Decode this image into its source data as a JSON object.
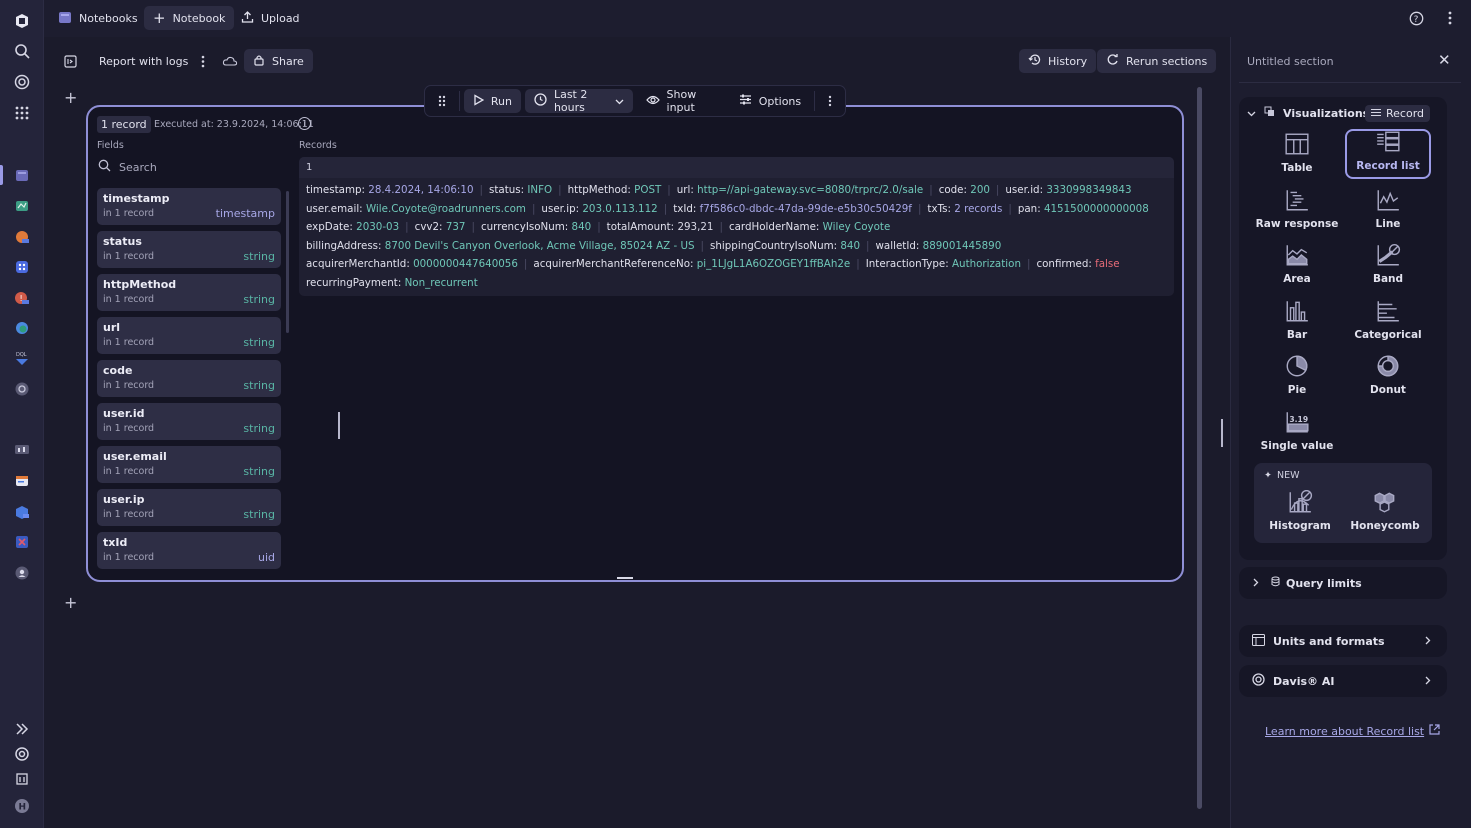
{
  "topbar": {
    "app_name": "Notebooks",
    "new_notebook_label": "Notebook",
    "upload_label": "Upload"
  },
  "notebook": {
    "title": "Report with logs",
    "share_label": "Share",
    "history_label": "History",
    "rerun_label": "Rerun sections"
  },
  "section_toolbar": {
    "run_label": "Run",
    "timeframe": "Last 2 hours",
    "show_input_label": "Show input",
    "options_label": "Options"
  },
  "result": {
    "record_badge": "1 record",
    "executed_at": "Executed at: 23.9.2024, 14:06:11",
    "fields_label": "Fields",
    "records_label": "Records",
    "search_placeholder": "Search",
    "fields": [
      {
        "name": "timestamp",
        "count": "in 1 record",
        "type": "timestamp"
      },
      {
        "name": "status",
        "count": "in 1 record",
        "type": "string"
      },
      {
        "name": "httpMethod",
        "count": "in 1 record",
        "type": "string"
      },
      {
        "name": "url",
        "count": "in 1 record",
        "type": "string"
      },
      {
        "name": "code",
        "count": "in 1 record",
        "type": "string"
      },
      {
        "name": "user.id",
        "count": "in 1 record",
        "type": "string"
      },
      {
        "name": "user.email",
        "count": "in 1 record",
        "type": "string"
      },
      {
        "name": "user.ip",
        "count": "in 1 record",
        "type": "string"
      },
      {
        "name": "txId",
        "count": "in 1 record",
        "type": "uid"
      }
    ],
    "record_index": "1",
    "record_lines": [
      [
        {
          "k": "timestamp",
          "v": "28.4.2024, 14:06:10",
          "c": "vp"
        },
        {
          "k": "status",
          "v": "INFO",
          "c": "v"
        },
        {
          "k": "httpMethod",
          "v": "POST",
          "c": "v"
        },
        {
          "k": "url",
          "v": "http=//api-gateway.svc=8080/trprc/2.0/sale",
          "c": "v"
        },
        {
          "k": "code",
          "v": "200",
          "c": "v"
        },
        {
          "k": "user.id",
          "v": "3330998349843",
          "c": "v"
        }
      ],
      [
        {
          "k": "user.email",
          "v": "Wile.Coyote@roadrunners.com",
          "c": "v"
        },
        {
          "k": "user.ip",
          "v": "203.0.113.112",
          "c": "v"
        },
        {
          "k": "txId",
          "v": "f7f586c0-dbdc-47da-99de-e5b30c50429f",
          "c": "vp"
        },
        {
          "k": "txTs",
          "v": "2 records",
          "c": "vp"
        },
        {
          "k": "pan",
          "v": "4151500000000008",
          "c": "v"
        }
      ],
      [
        {
          "k": "expDate",
          "v": "2030-03",
          "c": "v"
        },
        {
          "k": "cvv2",
          "v": "737",
          "c": "v"
        },
        {
          "k": "currencyIsoNum",
          "v": "840",
          "c": "v"
        },
        {
          "k": "totalAmount",
          "v": "293,21",
          "c": "vw"
        },
        {
          "k": "cardHolderName",
          "v": "Wiley Coyote",
          "c": "v"
        }
      ],
      [
        {
          "k": "billingAddress",
          "v": "8700 Devil's Canyon Overlook, Acme Village, 85024 AZ - US",
          "c": "v"
        },
        {
          "k": "shippingCountryIsoNum",
          "v": "840",
          "c": "v"
        },
        {
          "k": "walletId",
          "v": "889001445890",
          "c": "v"
        }
      ],
      [
        {
          "k": "acquirerMerchantId",
          "v": "0000000447640056",
          "c": "v"
        },
        {
          "k": "acquirerMerchantReferenceNo",
          "v": "pi_1LJgL1A6OZOGEY1ffBAh2e",
          "c": "v"
        },
        {
          "k": "InteractionType",
          "v": "Authorization",
          "c": "v"
        },
        {
          "k": "confirmed",
          "v": "false",
          "c": "vr"
        }
      ],
      [
        {
          "k": "recurringPayment",
          "v": "Non_recurrent",
          "c": "v"
        }
      ]
    ]
  },
  "right_panel": {
    "title": "Untitled section",
    "visualizations_label": "Visualizations",
    "record_pill": "Record",
    "viz_options": [
      {
        "label": "Table",
        "icon": "table-icon",
        "selected": false
      },
      {
        "label": "Record list",
        "icon": "record-list-icon",
        "selected": true
      },
      {
        "label": "Raw response",
        "icon": "raw-response-icon",
        "selected": false
      },
      {
        "label": "Line",
        "icon": "line-chart-icon",
        "selected": false
      },
      {
        "label": "Area",
        "icon": "area-chart-icon",
        "selected": false
      },
      {
        "label": "Band",
        "icon": "band-chart-icon",
        "selected": false
      },
      {
        "label": "Bar",
        "icon": "bar-chart-icon",
        "selected": false
      },
      {
        "label": "Categorical",
        "icon": "categorical-chart-icon",
        "selected": false
      },
      {
        "label": "Pie",
        "icon": "pie-chart-icon",
        "selected": false
      },
      {
        "label": "Donut",
        "icon": "donut-chart-icon",
        "selected": false
      },
      {
        "label": "Single value",
        "icon": "single-value-icon",
        "selected": false,
        "sample": "3.19"
      }
    ],
    "new_label": "NEW",
    "new_options": [
      {
        "label": "Histogram",
        "icon": "histogram-icon"
      },
      {
        "label": "Honeycomb",
        "icon": "honeycomb-icon"
      }
    ],
    "query_limits_label": "Query limits",
    "units_label": "Units and formats",
    "davis_label": "Davis® AI",
    "learn_more": "Learn more about Record list"
  }
}
